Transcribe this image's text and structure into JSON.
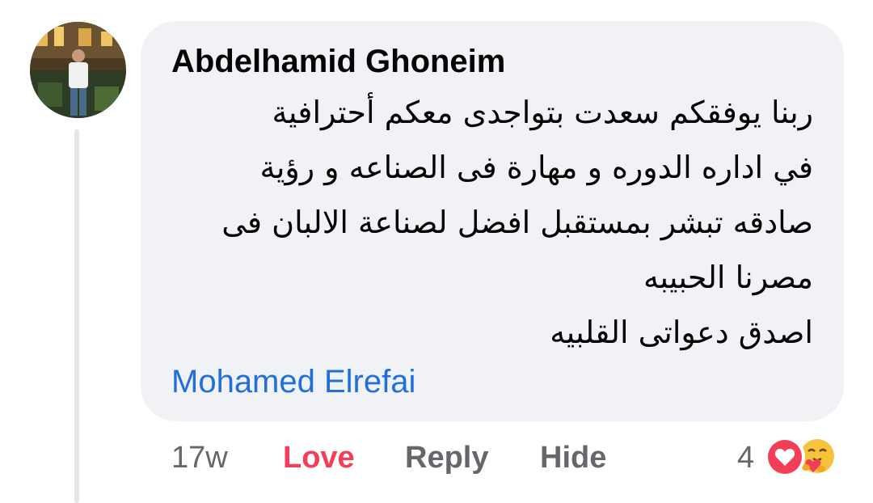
{
  "comment": {
    "author": "Abdelhamid Ghoneim",
    "text_lines": [
      "ربنا يوفقكم سعدت بتواجدى معكم أحترافية",
      "في اداره الدوره و مهارة فى الصناعه و رؤية",
      "صادقه تبشر بمستقبل افضل لصناعة الالبان فى",
      "مصرنا الحبيبه",
      "اصدق دعواتى القلبيه"
    ],
    "mention": "Mohamed Elrefai"
  },
  "actions": {
    "time": "17w",
    "love": "Love",
    "reply": "Reply",
    "hide": "Hide"
  },
  "reactions": {
    "count": "4",
    "icons": [
      "heart-icon",
      "care-icon"
    ]
  },
  "colors": {
    "bubble": "#f0f2f5",
    "love": "#f33e58",
    "mention": "#216fdb",
    "muted": "#65676b"
  }
}
